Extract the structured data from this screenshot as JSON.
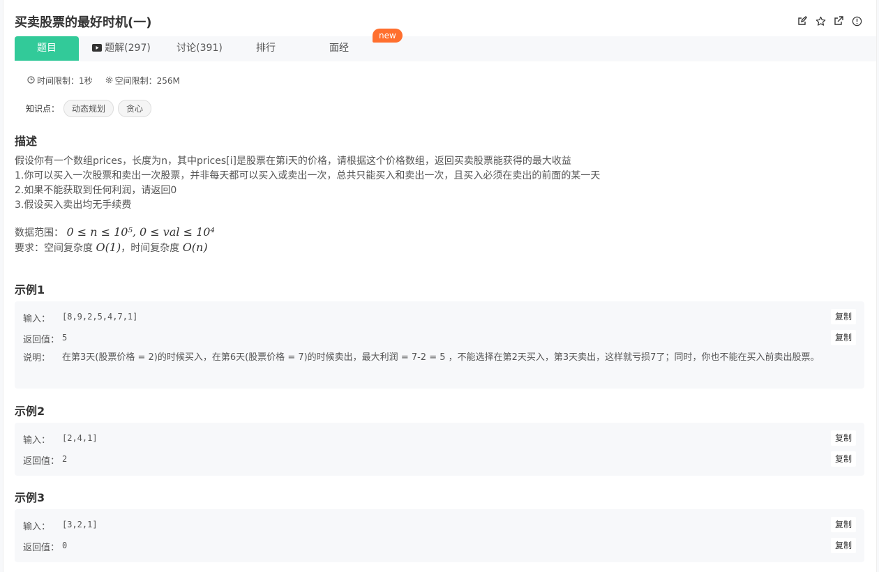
{
  "problem": {
    "title": "买卖股票的最好时机(一)"
  },
  "toolbar": {
    "icons": [
      "edit-icon",
      "star-icon",
      "external-link-icon",
      "info-icon"
    ]
  },
  "tabs": [
    {
      "label": "题目"
    },
    {
      "label": "题解(297)"
    },
    {
      "label": "讨论(391)"
    },
    {
      "label": "排行"
    },
    {
      "label": "面经"
    }
  ],
  "new_badge": "new",
  "limits": {
    "time": "时间限制：1秒",
    "space": "空间限制：256M"
  },
  "knowledge": {
    "label": "知识点：",
    "tags": [
      "动态规划",
      "贪心"
    ]
  },
  "description": {
    "heading": "描述",
    "lines": [
      "假设你有一个数组prices，长度为n，其中prices[i]是股票在第i天的价格，请根据这个价格数组，返回买卖股票能获得的最大收益",
      "1.你可以买入一次股票和卖出一次股票，并非每天都可以买入或卖出一次，总共只能买入和卖出一次，且买入必须在卖出的前面的某一天",
      "2.如果不能获取到任何利润，请返回0",
      "3.假设买入卖出均无手续费"
    ],
    "range_label": "数据范围：",
    "range_formula": "0 ≤ n ≤ 10⁵, 0 ≤ val ≤ 10⁴",
    "req_label": "要求：空间复杂度 ",
    "req_space": "O(1)",
    "req_mid": "，时间复杂度 ",
    "req_time": "O(n)"
  },
  "labels": {
    "input": "输入：",
    "return": "返回值：",
    "explain": "说明：",
    "copy": "复制"
  },
  "examples": [
    {
      "heading": "示例1",
      "input": "[8,9,2,5,4,7,1]",
      "output": "5",
      "explanation": "在第3天(股票价格 = 2)的时候买入，在第6天(股票价格 = 7)的时候卖出，最大利润 = 7-2 = 5 ，不能选择在第2天买入，第3天卖出，这样就亏损7了；同时，你也不能在买入前卖出股票。"
    },
    {
      "heading": "示例2",
      "input": "[2,4,1]",
      "output": "2"
    },
    {
      "heading": "示例3",
      "input": "[3,2,1]",
      "output": "0"
    }
  ]
}
